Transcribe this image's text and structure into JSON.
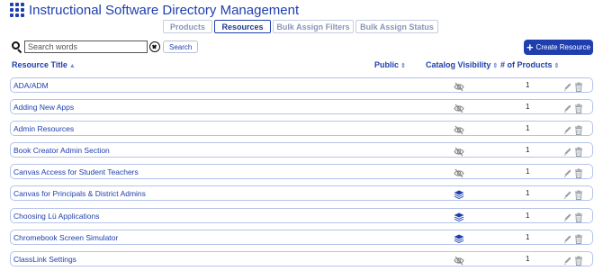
{
  "app": {
    "title": "Instructional Software Directory Management"
  },
  "tabs": [
    {
      "label": "Products",
      "active": false
    },
    {
      "label": "Resources",
      "active": true
    },
    {
      "label": "Bulk Assign Filters",
      "active": false
    },
    {
      "label": "Bulk Assign Status",
      "active": false
    }
  ],
  "search": {
    "placeholder": "Search words",
    "value": "",
    "button_label": "Search"
  },
  "create_button": {
    "label": "Create Resource"
  },
  "columns": {
    "title": "Resource Title",
    "public": "Public",
    "visibility": "Catalog Visibility",
    "products": "# of Products"
  },
  "rows": [
    {
      "title": "ADA/ADM",
      "visibility": "hidden-icon",
      "products": "1"
    },
    {
      "title": "Adding New Apps",
      "visibility": "hidden-icon",
      "products": "1"
    },
    {
      "title": "Admin Resources",
      "visibility": "hidden-icon",
      "products": "1"
    },
    {
      "title": "Book Creator Admin Section",
      "visibility": "hidden-icon",
      "products": "1"
    },
    {
      "title": "Canvas Access for Student Teachers",
      "visibility": "hidden-icon",
      "products": "1"
    },
    {
      "title": "Canvas for Principals & District Admins",
      "visibility": "layers-icon",
      "products": "1"
    },
    {
      "title": "Choosing Lü Applications",
      "visibility": "layers-icon",
      "products": "1"
    },
    {
      "title": "Chromebook Screen Simulator",
      "visibility": "layers-icon",
      "products": "1"
    },
    {
      "title": "ClassLink Settings",
      "visibility": "hidden-icon",
      "products": "1"
    }
  ],
  "colors": {
    "accent": "#1f3fae",
    "row_border": "#b5c3ea",
    "muted_icon": "#8a8a8a"
  }
}
